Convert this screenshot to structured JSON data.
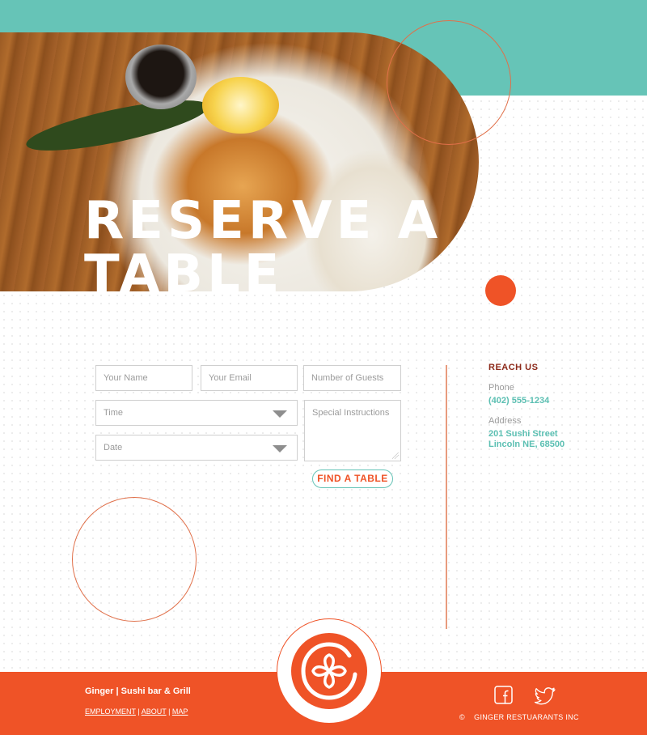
{
  "hero": {
    "title_line1": "RESERVE A",
    "title_line2": "TABLE"
  },
  "form": {
    "name_placeholder": "Your Name",
    "email_placeholder": "Your Email",
    "guests_placeholder": "Number of Guests",
    "time_label": "Time",
    "date_label": "Date",
    "instructions_placeholder": "Special Instructions",
    "submit_label": "FIND A TABLE"
  },
  "reach": {
    "title": "REACH US",
    "phone_label": "Phone",
    "phone_value": "(402) 555-1234",
    "address_label": "Address",
    "address_line1": "201 Sushi Street",
    "address_line2": "Lincoln NE, 68500"
  },
  "footer": {
    "brand": "Ginger | Sushi bar & Grill",
    "links": [
      "EMPLOYMENT",
      "ABOUT",
      "MAP"
    ],
    "copyright_symbol": "©",
    "copyright_text": "GINGER RESTUARANTS INC"
  },
  "colors": {
    "teal": "#66c4b7",
    "orange": "#ef5327",
    "dark_red": "#8d2a1a"
  },
  "icons": {
    "facebook": "facebook-icon",
    "twitter": "twitter-icon",
    "logo": "ginger-flower-logo"
  }
}
